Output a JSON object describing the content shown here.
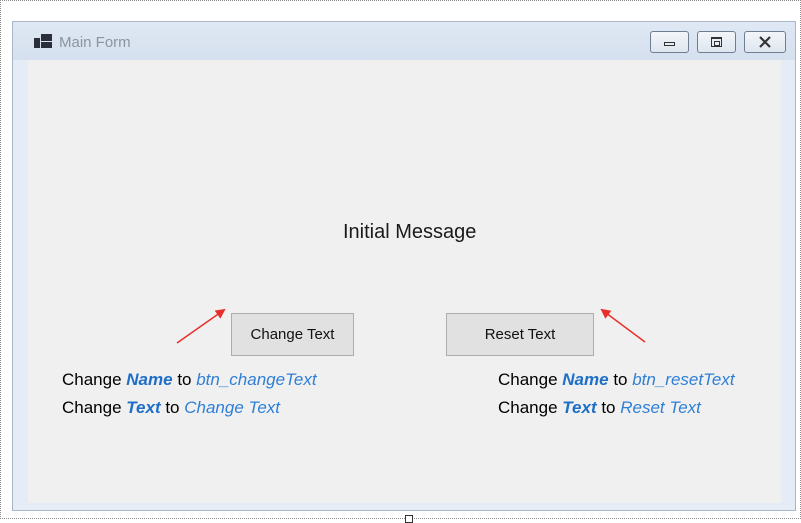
{
  "window": {
    "title": "Main Form"
  },
  "form": {
    "message_label": "Initial Message",
    "change_button_label": "Change Text",
    "reset_button_label": "Reset Text"
  },
  "annotations": {
    "left": {
      "line1": {
        "prefix": "Change ",
        "keyword": "Name",
        "middle": " to ",
        "value": "btn_changeText"
      },
      "line2": {
        "prefix": "Change ",
        "keyword": "Text",
        "middle": " to ",
        "value": "Change Text"
      }
    },
    "right": {
      "line1": {
        "prefix": "Change ",
        "keyword": "Name",
        "middle": " to ",
        "value": "btn_resetText"
      },
      "line2": {
        "prefix": "Change ",
        "keyword": "Text",
        "middle": " to ",
        "value": "Reset Text"
      }
    },
    "arrow_color": "#e8302a",
    "keyword_color": "#1f6fc7"
  },
  "icons": {
    "app": "window-icon",
    "minimize": "minimize-icon",
    "maximize": "maximize-icon",
    "close": "close-icon"
  }
}
